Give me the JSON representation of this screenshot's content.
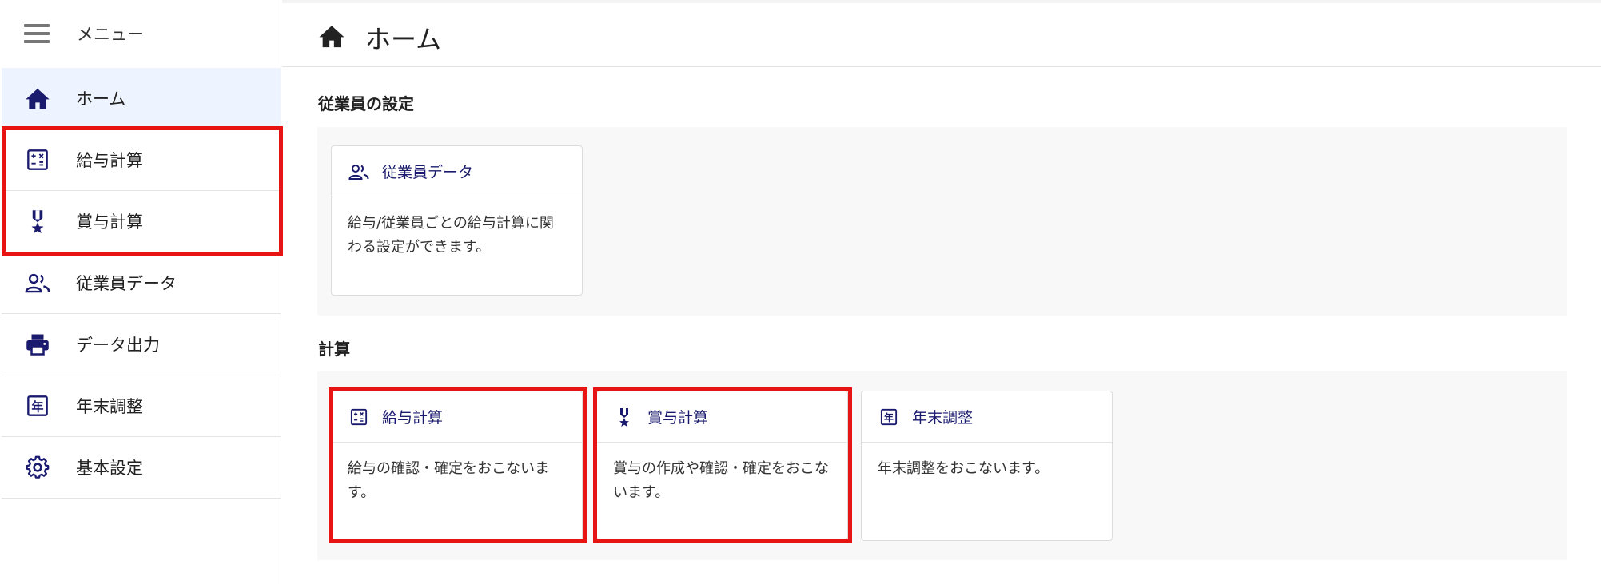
{
  "sidebar": {
    "menu_label": "メニュー",
    "items": [
      {
        "label": "ホーム",
        "icon": "home-icon"
      },
      {
        "label": "給与計算",
        "icon": "calculator-icon"
      },
      {
        "label": "賞与計算",
        "icon": "medal-icon"
      },
      {
        "label": "従業員データ",
        "icon": "people-icon"
      },
      {
        "label": "データ出力",
        "icon": "printer-icon"
      },
      {
        "label": "年末調整",
        "icon": "year-icon"
      },
      {
        "label": "基本設定",
        "icon": "gear-icon"
      }
    ],
    "active_index": 0,
    "year_glyph": "年"
  },
  "header": {
    "title": "ホーム"
  },
  "sections": [
    {
      "title": "従業員の設定",
      "cards": [
        {
          "title": "従業員データ",
          "icon": "people-icon",
          "description": "給与/従業員ごとの給与計算に関わる設定ができます。"
        }
      ]
    },
    {
      "title": "計算",
      "cards": [
        {
          "title": "給与計算",
          "icon": "calculator-icon",
          "description": "給与の確認・確定をおこないます。"
        },
        {
          "title": "賞与計算",
          "icon": "medal-icon",
          "description": "賞与の作成や確認・確定をおこないます。"
        },
        {
          "title": "年末調整",
          "icon": "year-icon",
          "description": "年末調整をおこないます。"
        }
      ]
    }
  ],
  "colors": {
    "accent": "#1a1a6e",
    "highlight": "#e81414",
    "active_bg": "#eef4ff"
  }
}
